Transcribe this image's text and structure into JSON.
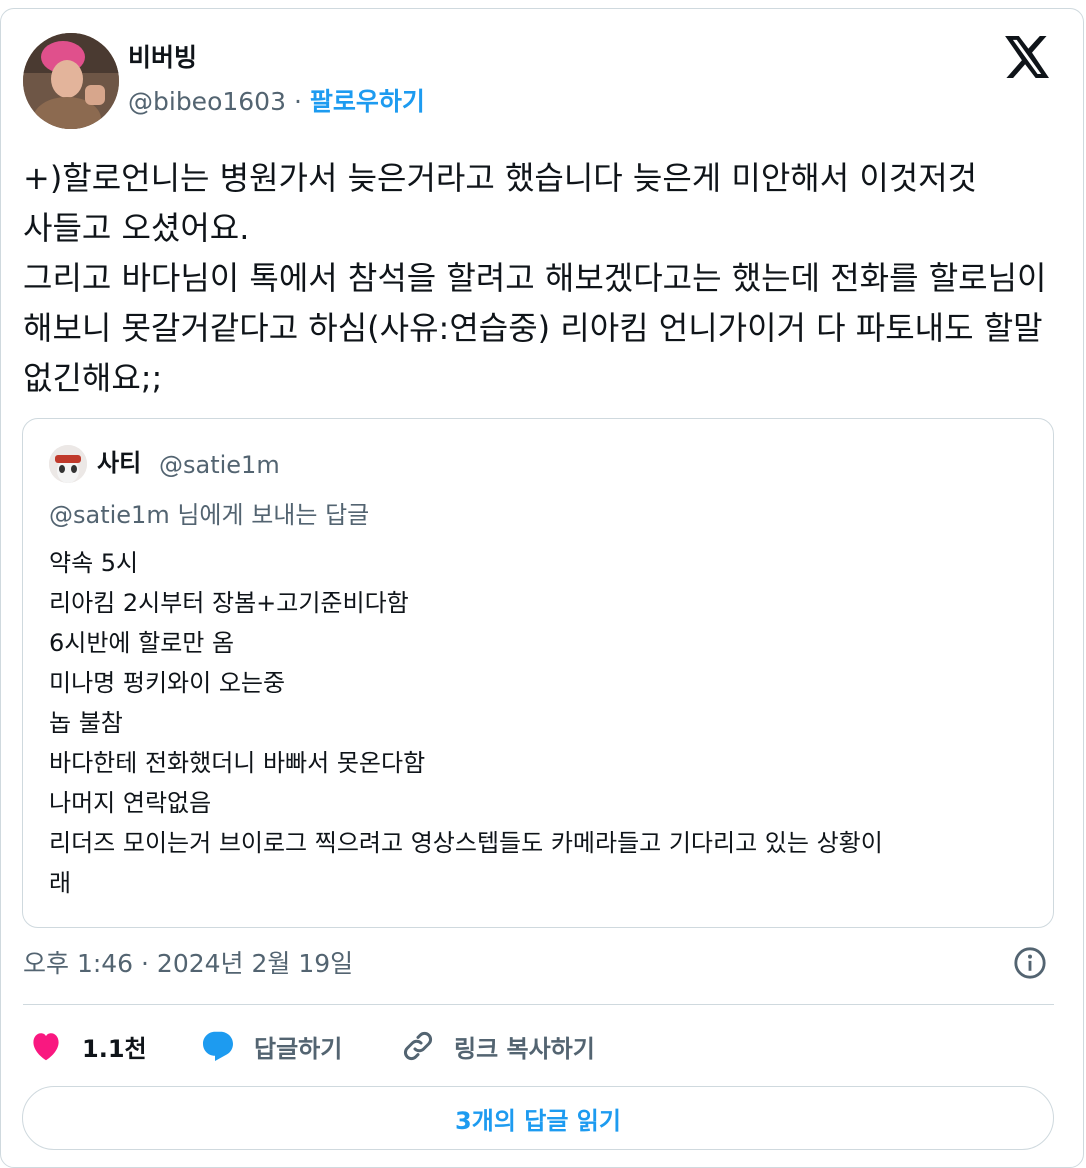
{
  "author": {
    "name": "비버빙",
    "handle": "@bibeo1603",
    "separator": "·",
    "follow_label": "팔로우하기"
  },
  "tweet_text": "+)할로언니는 병원가서 늦은거라고 했습니다 늦은게 미안해서 이것저것 사들고 오셨어요.\n그리고 바다님이 톡에서 참석을 할려고 해보겠다고는 했는데 전화를 할로님이 해보니 못갈거같다고 하심(사유:연습중) 리아킴 언니가이거 다 파토내도 할말 없긴해요;;",
  "quote": {
    "name": "사티",
    "handle": "@satie1m",
    "reply_to": "@satie1m 님에게 보내는 답글",
    "lines": [
      "약속 5시",
      "리아킴 2시부터 장봄+고기준비다함",
      "6시반에 할로만 옴",
      "미나명 펑키와이 오는중",
      "놉 불참",
      "바다한테 전화했더니 바빠서 못온다함",
      "나머지 연락없음",
      "리더즈 모이는거 브이로그 찍으려고 영상스텝들도 카메라들고 기다리고 있는 상황이",
      "래"
    ]
  },
  "timestamp": "오후 1:46 · 2024년 2월 19일",
  "actions": {
    "like_count": "1.1천",
    "reply_label": "답글하기",
    "copy_link_label": "링크 복사하기"
  },
  "read_replies_label": "3개의 답글 읽기",
  "colors": {
    "accent": "#1d9bf0",
    "like": "#f91880",
    "text": "#0f1419",
    "muted": "#536471",
    "border": "#cfd9de"
  },
  "icons": [
    "x-logo-icon",
    "info-icon",
    "heart-icon",
    "reply-bubble-icon",
    "link-icon"
  ]
}
